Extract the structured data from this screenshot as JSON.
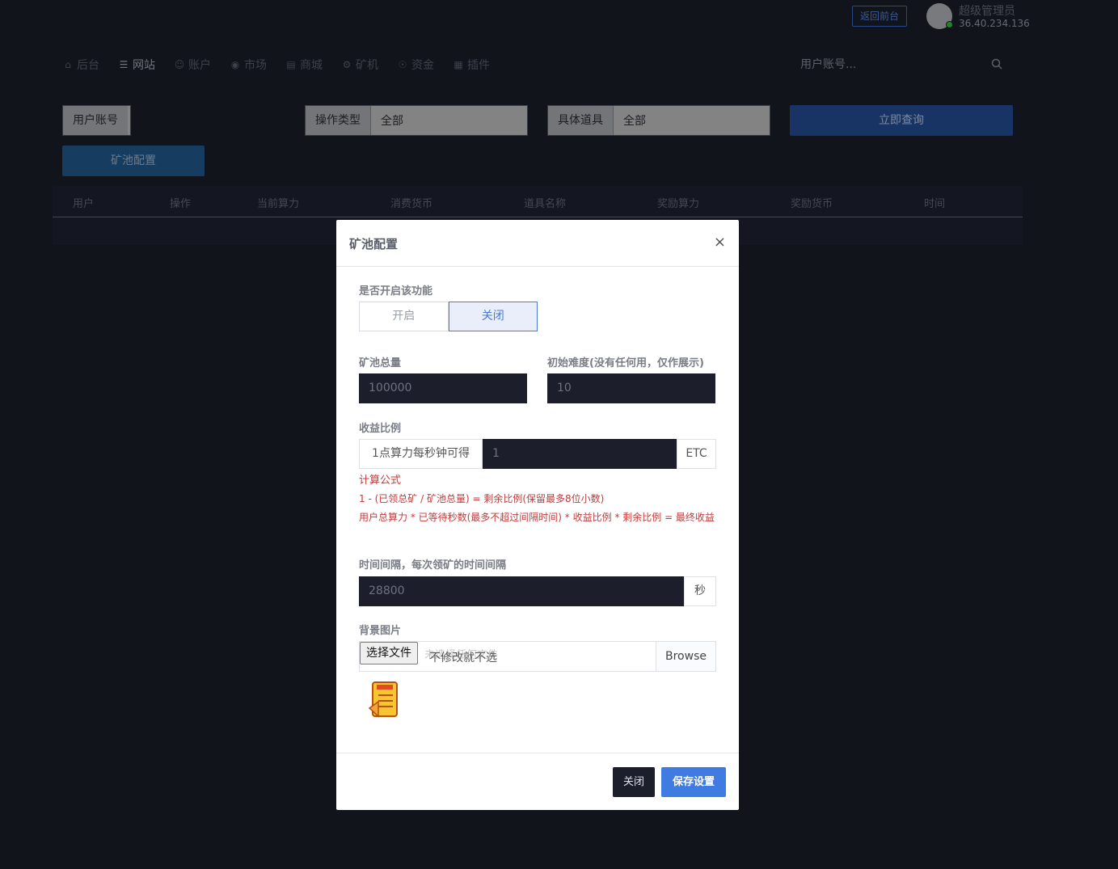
{
  "header": {
    "back_label": "返回前台",
    "admin_name": "超级管理员",
    "admin_ip": "36.40.234.136"
  },
  "nav": {
    "items": [
      {
        "label": "后台",
        "icon": "home-icon"
      },
      {
        "label": "网站",
        "icon": "list-icon"
      },
      {
        "label": "账户",
        "icon": "users-icon"
      },
      {
        "label": "市场",
        "icon": "globe-icon"
      },
      {
        "label": "商城",
        "icon": "cart-icon"
      },
      {
        "label": "矿机",
        "icon": "gear-icon"
      },
      {
        "label": "资金",
        "icon": "money-icon"
      },
      {
        "label": "插件",
        "icon": "grid-icon"
      }
    ],
    "active_index": 1,
    "search_placeholder": "用户账号..."
  },
  "filters": {
    "user_label": "用户账号",
    "op_type_label": "操作类型",
    "op_type_value": "全部",
    "item_label": "具体道具",
    "item_value": "全部",
    "query_label": "立即查询",
    "pool_config_label": "矿池配置"
  },
  "table": {
    "columns": [
      "用户",
      "操作",
      "当前算力",
      "消费货币",
      "道具名称",
      "奖励算力",
      "奖励货币",
      "时间"
    ]
  },
  "modal": {
    "title": "矿池配置",
    "close_symbol": "×",
    "enable_label": "是否开启该功能",
    "toggle_on": "开启",
    "toggle_off": "关闭",
    "toggle_selected": "关闭",
    "pool_total_label": "矿池总量",
    "pool_total_value": "100000",
    "difficulty_label": "初始难度(没有任何用，仅作展示)",
    "difficulty_value": "10",
    "ratio_label": "收益比例",
    "ratio_prefix": "1点算力每秒钟可得",
    "ratio_value": "1",
    "ratio_unit": "ETC",
    "formula_title": "计算公式",
    "formula_line1": "1 - (已领总矿 / 矿池总量) = 剩余比例(保留最多8位小数)",
    "formula_line2": "用户总算力 * 已等待秒数(最多不超过间隔时间) * 收益比例 * 剩余比例 = 最终收益",
    "interval_label": "时间间隔，每次领矿的时间间隔",
    "interval_value": "28800",
    "interval_unit": "秒",
    "bg_label": "背景图片",
    "file_choose": "选择文件",
    "file_none": "未选择任何文件",
    "file_hint": "不修改就不选",
    "file_browse": "Browse",
    "btn_close": "关闭",
    "btn_save": "保存设置"
  }
}
